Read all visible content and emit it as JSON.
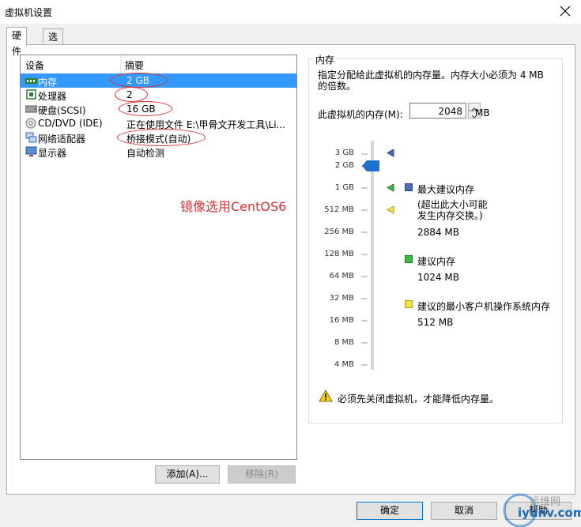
{
  "window": {
    "title": "虚拟机设置"
  },
  "tabs": [
    {
      "label": "硬件"
    },
    {
      "label": "选项"
    }
  ],
  "device_list": {
    "headers": [
      "设备",
      "摘要"
    ],
    "rows": [
      {
        "name": "内存",
        "summary": "2 GB",
        "icon": "memory-icon",
        "selected": true
      },
      {
        "name": "处理器",
        "summary": "2",
        "icon": "cpu-icon"
      },
      {
        "name": "硬盘(SCSI)",
        "summary": "16 GB",
        "icon": "harddisk-icon"
      },
      {
        "name": "CD/DVD (IDE)",
        "summary": "正在使用文件 E:\\甲骨文开发工具\\Li...",
        "icon": "cdrom-icon"
      },
      {
        "name": "网络适配器",
        "summary": "桥接模式(自动)",
        "icon": "network-adapter-icon"
      },
      {
        "name": "显示器",
        "summary": "自动检测",
        "icon": "monitor-icon"
      }
    ]
  },
  "annotation": {
    "text": "镜像选用CentOS6",
    "color": "#d93030"
  },
  "list_buttons": {
    "add": "添加(A)...",
    "remove": "移除(R)"
  },
  "memory": {
    "group_title": "内存",
    "description": "指定分配给此虚拟机的内存量。内存大小必须为 4 MB 的倍数。",
    "label": "此虚拟机的内存(M):",
    "value": "2048",
    "unit": "MB",
    "scale": [
      "3 GB",
      "2 GB",
      "1 GB",
      "512 MB",
      "256 MB",
      "128 MB",
      "64 MB",
      "32 MB",
      "16 MB",
      "8 MB",
      "4 MB"
    ],
    "legend": {
      "max": {
        "title": "最大建议内存",
        "note": "(超出此大小可能\n发生内存交换。)",
        "value": "2884 MB",
        "color": "#4a6fb5"
      },
      "recommended": {
        "title": "建议内存",
        "value": "1024 MB",
        "color": "#3cb84a"
      },
      "min_guest": {
        "title": "建议的最小客户机操作系统内存",
        "value": "512 MB",
        "color": "#f2e24a"
      }
    },
    "warning": "必须先关闭虚拟机，才能降低内存量。"
  },
  "footer_buttons": {
    "ok": "确定",
    "cancel": "取消",
    "help": "帮助"
  },
  "watermark": {
    "line1": "运维网",
    "line2": "iyunv.com"
  }
}
